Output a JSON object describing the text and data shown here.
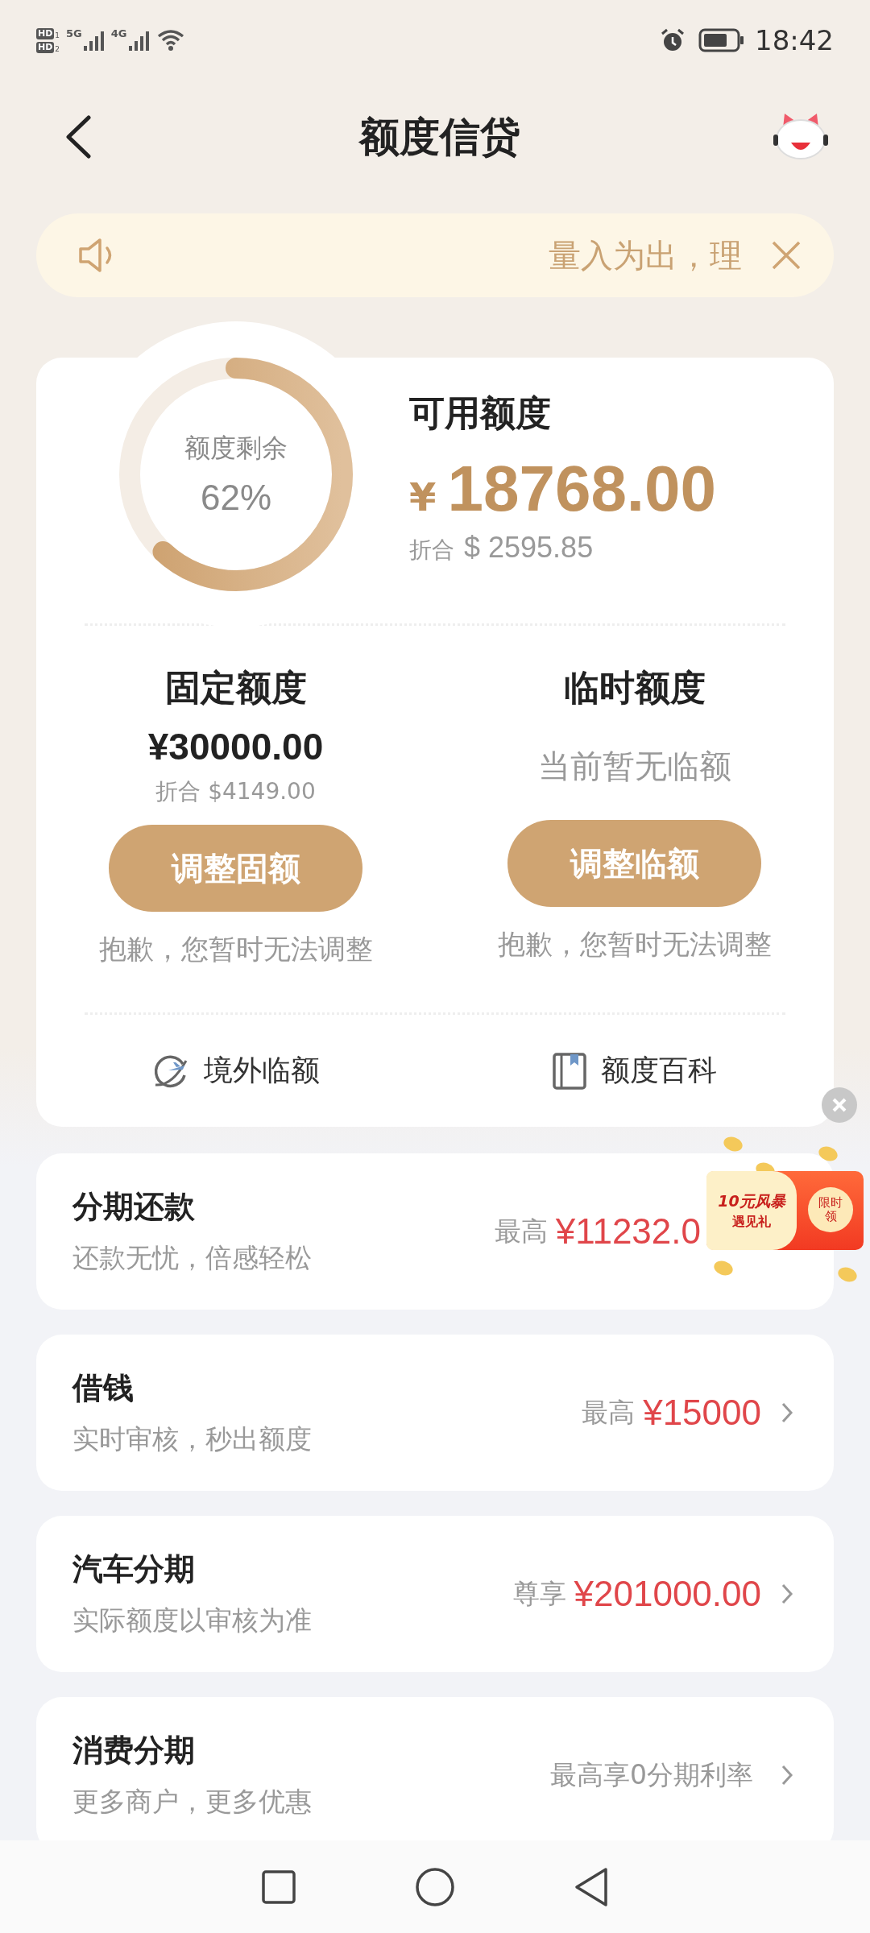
{
  "status_bar": {
    "sims": [
      {
        "badge": "HD",
        "slot": "1",
        "network": "5G"
      },
      {
        "badge": "HD",
        "slot": "2",
        "network": "4G"
      }
    ],
    "time": "18:42"
  },
  "header": {
    "title": "额度信贷"
  },
  "notice": {
    "text": "量入为出，理"
  },
  "summary": {
    "ring": {
      "label": "额度剩余",
      "percent": "62%",
      "level": 0.62
    },
    "available": {
      "label": "可用额度",
      "currency": "¥",
      "amount": "18768.00",
      "converted_label": "折合",
      "converted_amount": "$ 2595.85"
    }
  },
  "limits": [
    {
      "kind": "amount",
      "title": "固定额度",
      "amount": "¥30000.00",
      "converted": "折合 $4149.00",
      "button": "调整固额",
      "note": "抱歉，您暂时无法调整"
    },
    {
      "kind": "empty",
      "title": "临时额度",
      "empty_text": "当前暂无临额",
      "button": "调整临额",
      "note": "抱歉，您暂时无法调整"
    }
  ],
  "shortcuts": [
    {
      "kind": "overseas",
      "label": "境外临额"
    },
    {
      "kind": "guide",
      "label": "额度百科"
    }
  ],
  "products": [
    {
      "title": "分期还款",
      "subtitle": "还款无忧，倍感轻松",
      "prefix": "最高",
      "value": "¥11232.0",
      "chevron": false
    },
    {
      "title": "借钱",
      "subtitle": "实时审核，秒出额度",
      "prefix": "最高",
      "value": "¥15000",
      "chevron": true
    },
    {
      "title": "汽车分期",
      "subtitle": "实际额度以审核为准",
      "prefix": "尊享",
      "value": "¥201000.00",
      "chevron": true
    },
    {
      "title": "消费分期",
      "subtitle": "更多商户，更多优惠",
      "prefix": "最高享0分期利率",
      "chevron": true
    }
  ],
  "promo": {
    "title": "10元风暴",
    "subtitle": "遇见礼",
    "badge": "限时领"
  }
}
